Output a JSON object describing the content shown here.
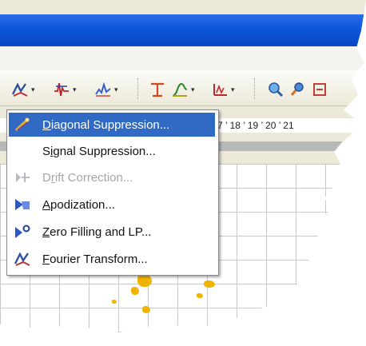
{
  "toolbar": {
    "buttons": [
      {
        "icon": "fourier-transform-icon",
        "has_dropdown": true
      },
      {
        "icon": "phase-correction-icon",
        "has_dropdown": true
      },
      {
        "icon": "baseline-correction-icon",
        "has_dropdown": true
      },
      {
        "icon": "peak-picking-icon",
        "has_dropdown": false
      },
      {
        "icon": "integration-icon",
        "has_dropdown": true
      },
      {
        "icon": "multiplet-analysis-icon",
        "has_dropdown": true
      },
      {
        "icon": "zoom-in-icon",
        "has_dropdown": false
      },
      {
        "icon": "zoom-settings-icon",
        "has_dropdown": false
      },
      {
        "icon": "more-tools-icon",
        "has_dropdown": false
      }
    ]
  },
  "ruler": {
    "text": "7 ’ 18 ’ 19 ’ 20 ’ 21"
  },
  "menu": {
    "items": [
      {
        "prefix": "",
        "mnemonic": "D",
        "rest": "iagonal Suppression...",
        "icon": "diagonal-suppression-icon",
        "state": "selected"
      },
      {
        "prefix": "S",
        "mnemonic": "i",
        "rest": "gnal Suppression...",
        "icon": "",
        "state": "normal"
      },
      {
        "prefix": "D",
        "mnemonic": "r",
        "rest": "ift Correction...",
        "icon": "drift-correction-icon",
        "state": "disabled"
      },
      {
        "prefix": "",
        "mnemonic": "A",
        "rest": "podization...",
        "icon": "apodization-icon",
        "state": "normal"
      },
      {
        "prefix": "",
        "mnemonic": "Z",
        "rest": "ero Filling and LP...",
        "icon": "zero-filling-icon",
        "state": "normal"
      },
      {
        "prefix": "",
        "mnemonic": "F",
        "rest": "ourier Transform...",
        "icon": "fourier-transform-icon",
        "state": "normal"
      }
    ]
  },
  "colors": {
    "title_bar": "#0a55d8",
    "menu_highlight": "#316ac5",
    "spectrum_peaks": "#f0b400"
  }
}
